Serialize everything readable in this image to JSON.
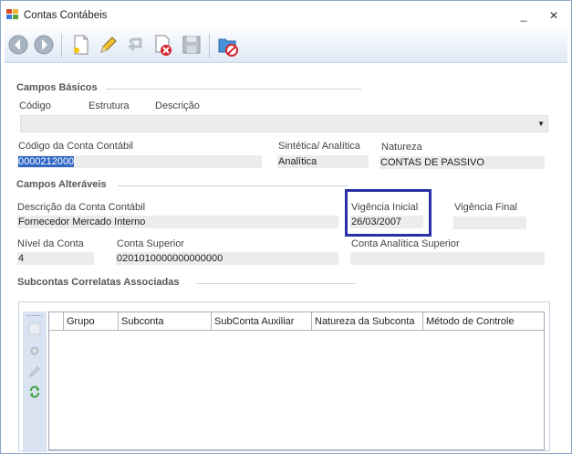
{
  "window": {
    "title": "Contas Contábeis",
    "minimize": "_",
    "close": "✕"
  },
  "toolbar": {
    "tools": [
      "back",
      "forward",
      "new",
      "edit",
      "undo",
      "delete",
      "save",
      "close-form"
    ]
  },
  "basic": {
    "group_title": "Campos Básicos",
    "codigo_label": "Código",
    "estrutura_label": "Estrutura",
    "descricao_label": "Descrição",
    "combo_arrow": "▼",
    "codigo_conta_label": "Código da Conta Contábil",
    "codigo_conta_value": "0000212000",
    "sintetica_label": "Sintética/ Analítica",
    "sintetica_value": "Analítica",
    "natureza_label": "Natureza",
    "natureza_value": "CONTAS DE PASSIVO"
  },
  "changeable": {
    "group_title": "Campos Alteráveis",
    "descricao_conta_label": "Descrição da Conta Contábil",
    "descricao_conta_value": "Fornecedor Mercado Interno",
    "vigencia_inicial_label": "Vigência Inicial",
    "vigencia_inicial_value": "26/03/2007",
    "vigencia_final_label": "Vigência Final",
    "vigencia_final_value": "",
    "nivel_label": "Nível da Conta",
    "nivel_value": "4",
    "conta_superior_label": "Conta Superior",
    "conta_superior_value": "0201010000000000000",
    "conta_analitica_label": "Conta Analítica Superior",
    "conta_analitica_value": ""
  },
  "subaccounts": {
    "group_title": "Subcontas Correlatas Associadas",
    "columns": [
      "Grupo",
      "Subconta",
      "SubConta Auxiliar",
      "Natureza da Subconta",
      "Método de Controle"
    ]
  }
}
